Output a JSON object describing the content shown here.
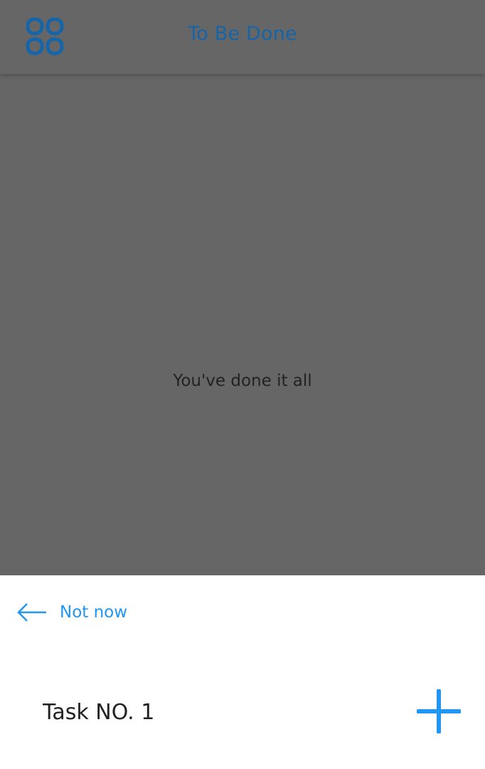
{
  "header": {
    "title": "To Be Done",
    "menu_icon": "grid-menu-icon"
  },
  "main": {
    "empty_message": "You've done it all"
  },
  "sheet": {
    "back_icon": "arrow-left-icon",
    "back_label": "Not now",
    "task_input_value": "Task NO. 1",
    "add_icon": "plus-icon"
  },
  "colors": {
    "accent": "#2196f3",
    "title": "#1565a8",
    "overlay_bg": "#666666",
    "sheet_bg": "#ffffff"
  }
}
